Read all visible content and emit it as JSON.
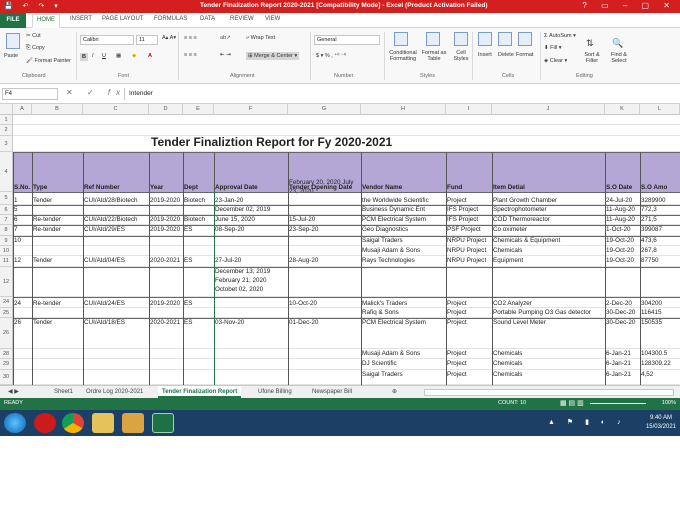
{
  "window": {
    "title": "Tender Finalization Report 2020-2021  [Compatibility Mode] - Excel (Product Activation Failed)",
    "controls": "? ▭ – ▢ ✕"
  },
  "ribbon_tabs": [
    "HOME",
    "INSERT",
    "PAGE LAYOUT",
    "FORMULAS",
    "DATA",
    "REVIEW",
    "VIEW"
  ],
  "file_tab": "FILE",
  "ribbon": {
    "clipboard": {
      "paste": "Paste",
      "cut": "Cut",
      "copy": "Copy",
      "format_painter": "Format Painter",
      "label": "Clipboard"
    },
    "font": {
      "name": "Calibri",
      "size": "11",
      "label": "Font"
    },
    "alignment": {
      "wrap": "Wrap Text",
      "merge": "Merge & Center",
      "label": "Alignment"
    },
    "number": {
      "format": "General",
      "label": "Number"
    },
    "styles": {
      "conditional": "Conditional Formatting",
      "format_table": "Format as Table",
      "cell_styles": "Cell Styles",
      "label": "Styles"
    },
    "cells": {
      "insert": "Insert",
      "delete": "Delete",
      "format": "Format",
      "label": "Cells"
    },
    "editing": {
      "autosum": "AutoSum",
      "fill": "Fill",
      "clear": "Clear",
      "sort": "Sort & Filter",
      "find": "Find & Select",
      "label": "Editing"
    }
  },
  "formula_bar": {
    "name_box": "F4",
    "fx": "fx",
    "formula": "Intender"
  },
  "columns": [
    "A",
    "B",
    "C",
    "D",
    "E",
    "F",
    "G",
    "H",
    "I",
    "J",
    "K",
    "L",
    "M"
  ],
  "rows": [
    "1",
    "2",
    "3",
    "4",
    "5",
    "6",
    "7",
    "8",
    "9",
    "10",
    "11",
    "12",
    "24",
    "25",
    "26",
    "28",
    "29",
    "30"
  ],
  "sheet_title": "Tender Finaliztion Report for Fy 2020-2021",
  "headers": [
    "S.No.",
    "Type",
    "Ref Number",
    "Year",
    "Dept",
    "Approval Date",
    "Tender Opening Date",
    "Vendor Name",
    "Fund",
    "Item Detial",
    "S.O Date",
    "S.O Amo"
  ],
  "table_rows": [
    {
      "sno": "1",
      "type": "Tender",
      "ref": "CUI/Atd/28/Biotech",
      "year": "2019-2020",
      "dept": "Biotech",
      "approval": "23-Jan-20",
      "opening": "February 20, 2020 July 23, 2020",
      "vendor": "the Worldwide Scientific",
      "fund": "Project",
      "item": "Plant Growth Chamber",
      "sodate": "24-Jul-20",
      "soamt": "3289900"
    },
    {
      "sno": "5",
      "type": "",
      "ref": "",
      "year": "",
      "dept": "",
      "approval": "December 02, 2019",
      "opening": "",
      "vendor": "Business Dynamic Ent",
      "fund": "IFS Project",
      "item": "Spectrophotometer",
      "sodate": "11-Aug-20",
      "soamt": "772,3"
    },
    {
      "sno": "6",
      "type": "Re-tender",
      "ref": "CUI/Atd/22/Biotech",
      "year": "2019-2020",
      "dept": "Biotech",
      "approval": "June 15, 2020",
      "opening": "15-Jul-20",
      "vendor": "PCM Electrical System",
      "fund": "IFS Project",
      "item": "COD Thermoreactor",
      "sodate": "11-Aug-20",
      "soamt": "271,5"
    },
    {
      "sno": "7",
      "type": "Re-tender",
      "ref": "CUI/Atd/29/ES",
      "year": "2019-2020",
      "dept": "ES",
      "approval": "08-Sep-20",
      "opening": "23-Sep-20",
      "vendor": "Geo Diagnostics",
      "fund": "PSF Project",
      "item": "Co oximeter",
      "sodate": "1-Oct-20",
      "soamt": "399087"
    },
    {
      "sno": "10",
      "type": "",
      "ref": "",
      "year": "",
      "dept": "",
      "approval": "",
      "opening": "",
      "vendor": "Saigal Traders",
      "fund": "NRPU Project",
      "item": "Chemicals & Equipment",
      "sodate": "19-Oct-20",
      "soamt": "473,6"
    },
    {
      "sno": "",
      "type": "",
      "ref": "",
      "year": "",
      "dept": "",
      "approval": "",
      "opening": "",
      "vendor": "Musaji Adam & Sons",
      "fund": "NRPU Project",
      "item": "Chemicals",
      "sodate": "19-Oct-20",
      "soamt": "267,8"
    },
    {
      "sno": "12",
      "type": "Tender",
      "ref": "CUI/Atd/04/ES",
      "year": "2020-2021",
      "dept": "ES",
      "approval": "27-Jul-20",
      "opening": "28-Aug-20",
      "vendor": "Rays Technologies",
      "fund": "NRPU Project",
      "item": "Equipment",
      "sodate": "19-Oct-20",
      "soamt": "87750"
    },
    {
      "sno": "24",
      "type": "Re-tender",
      "ref": "CUI/Atd/24/ES",
      "year": "2019-2020",
      "dept": "ES",
      "approval": "December 13, 2019 February 21, 2020 Octobet 02, 2020",
      "opening": "10-Oct-20",
      "vendor": "Malick's Traders",
      "fund": "Project",
      "item": "CO2 Analyzer",
      "sodate": "2-Dec-20",
      "soamt": "304200"
    },
    {
      "sno": "",
      "type": "",
      "ref": "",
      "year": "",
      "dept": "",
      "approval": "",
      "opening": "",
      "vendor": "Rafiq & Sons",
      "fund": "Project",
      "item": "Portable Pumping O3 Gas detector",
      "sodate": "30-Dec-20",
      "soamt": "116415"
    },
    {
      "sno": "26",
      "type": "Tender",
      "ref": "CUI/Atd/18/ES",
      "year": "2020-2021",
      "dept": "ES",
      "approval": "03-Nov-20",
      "opening": "01-Dec-20",
      "vendor": "PCM Electrical System",
      "fund": "Project",
      "item": "Sound Level Meter",
      "sodate": "30-Dec-20",
      "soamt": "150535"
    },
    {
      "sno": "",
      "type": "",
      "ref": "",
      "year": "",
      "dept": "",
      "approval": "",
      "opening": "",
      "vendor": "Musaji Adam & Sons",
      "fund": "Project",
      "item": "Chemicals",
      "sodate": "6-Jan-21",
      "soamt": "104300.5"
    },
    {
      "sno": "",
      "type": "",
      "ref": "",
      "year": "",
      "dept": "",
      "approval": "",
      "opening": "",
      "vendor": "DJ Scientific",
      "fund": "Project",
      "item": "Chemicals",
      "sodate": "6-Jan-21",
      "soamt": "128309.22"
    },
    {
      "sno": "",
      "type": "",
      "ref": "",
      "year": "",
      "dept": "",
      "approval": "",
      "opening": "",
      "vendor": "Saigal Traders",
      "fund": "Project",
      "item": "Chemicals",
      "sodate": "6-Jan-21",
      "soamt": "4,52"
    }
  ],
  "sheet_tabs": [
    "Sheet1",
    "Ordre Log 2020-2021",
    "Tender Finalization Report",
    "Ufone Billing",
    "Newspaper Bill"
  ],
  "status": {
    "ready": "READY",
    "count": "COUNT: 10",
    "zoom": "100%"
  },
  "clock": {
    "time": "9:40 AM",
    "date": "15/03/2021"
  },
  "colors": {
    "excel_green": "#217346",
    "title_red": "#d41f1f",
    "header_fill": "#b4a7d6",
    "taskbar": "#1c3f66"
  }
}
